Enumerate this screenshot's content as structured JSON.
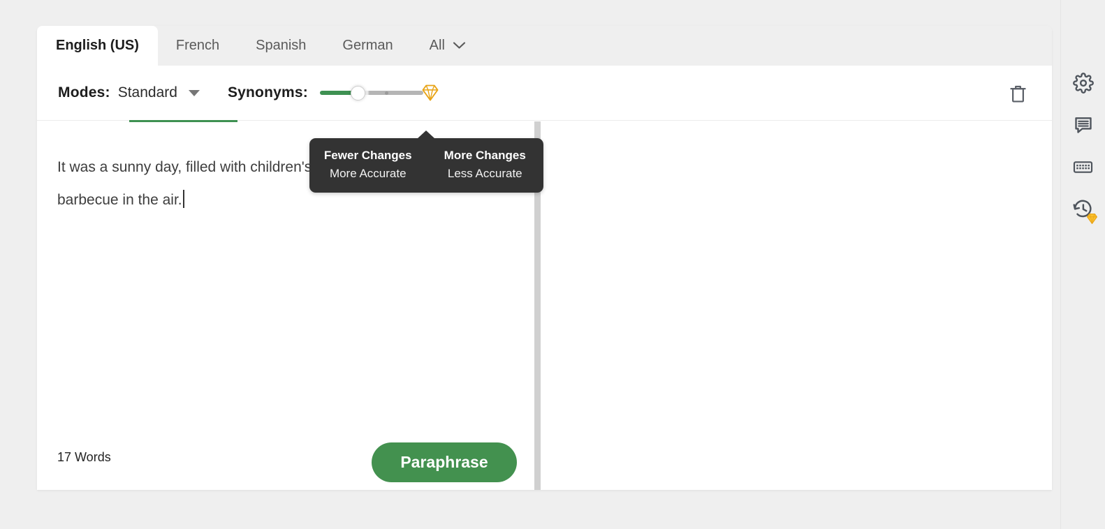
{
  "language_tabs": [
    {
      "label": "English (US)",
      "active": true
    },
    {
      "label": "French",
      "active": false
    },
    {
      "label": "Spanish",
      "active": false
    },
    {
      "label": "German",
      "active": false
    },
    {
      "label": "All",
      "active": false,
      "icon": "chevron-down-icon"
    }
  ],
  "toolbar": {
    "modes_label": "Modes:",
    "mode_selected": "Standard",
    "mode_caret_icon": "caret-down-icon",
    "synonyms_label": "Synonyms:",
    "delete_icon": "trash-icon"
  },
  "slider": {
    "name": "synonyms-slider",
    "value_percent": 30,
    "premium_icon": "diamond-icon"
  },
  "tooltip": {
    "left": {
      "title": "Fewer Changes",
      "subtitle": "More Accurate"
    },
    "right": {
      "title": "More Changes",
      "subtitle": "Less Accurate"
    }
  },
  "editor": {
    "text": "It was a sunny day, filled with children's laughter and the smell of barbecue in the air.",
    "word_count": "17 Words",
    "paraphrase_label": "Paraphrase"
  },
  "output_pane": {
    "text": ""
  },
  "rail": [
    {
      "name": "settings-icon",
      "label": "Settings"
    },
    {
      "name": "feedback-icon",
      "label": "Feedback"
    },
    {
      "name": "keyboard-icon",
      "label": "Keyboard shortcuts"
    },
    {
      "name": "history-icon",
      "label": "History",
      "badge": "diamond-icon"
    }
  ],
  "colors": {
    "accent_green": "#43914f",
    "premium_gold": "#e8a417",
    "tooltip_bg": "#333333",
    "page_bg": "#efefef"
  }
}
